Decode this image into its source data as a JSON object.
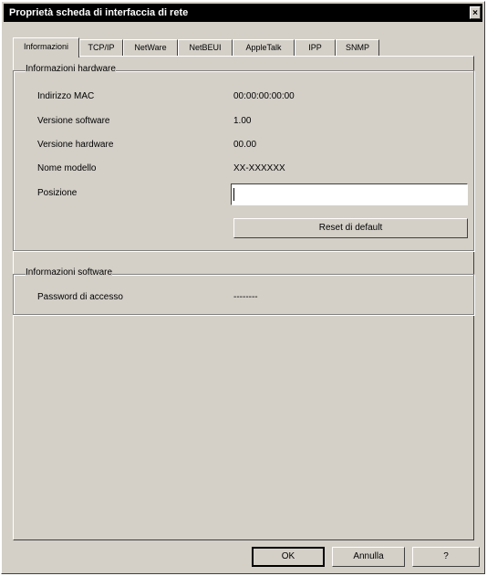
{
  "window": {
    "title": "Proprietà scheda di interfaccia di rete",
    "close_label": "×"
  },
  "tabs": [
    {
      "label": "Informazioni",
      "active": true
    },
    {
      "label": "TCP/IP"
    },
    {
      "label": "NetWare"
    },
    {
      "label": "NetBEUI"
    },
    {
      "label": "AppleTalk"
    },
    {
      "label": "IPP"
    },
    {
      "label": "SNMP"
    }
  ],
  "hardware_group": {
    "title": "Informazioni hardware",
    "rows": [
      {
        "label": "Indirizzo MAC",
        "value": "00:00:00:00:00"
      },
      {
        "label": "Versione software",
        "value": "1.00"
      },
      {
        "label": "Versione hardware",
        "value": "00.00"
      },
      {
        "label": "Nome modello",
        "value": "XX-XXXXXX"
      }
    ],
    "location": {
      "label": "Posizione",
      "value": ""
    },
    "reset_button": "Reset di default"
  },
  "software_group": {
    "title": "Informazioni software",
    "row": {
      "label": "Password di accesso",
      "value": "--------"
    }
  },
  "footer": {
    "ok": "OK",
    "cancel": "Annulla",
    "help": "?"
  }
}
